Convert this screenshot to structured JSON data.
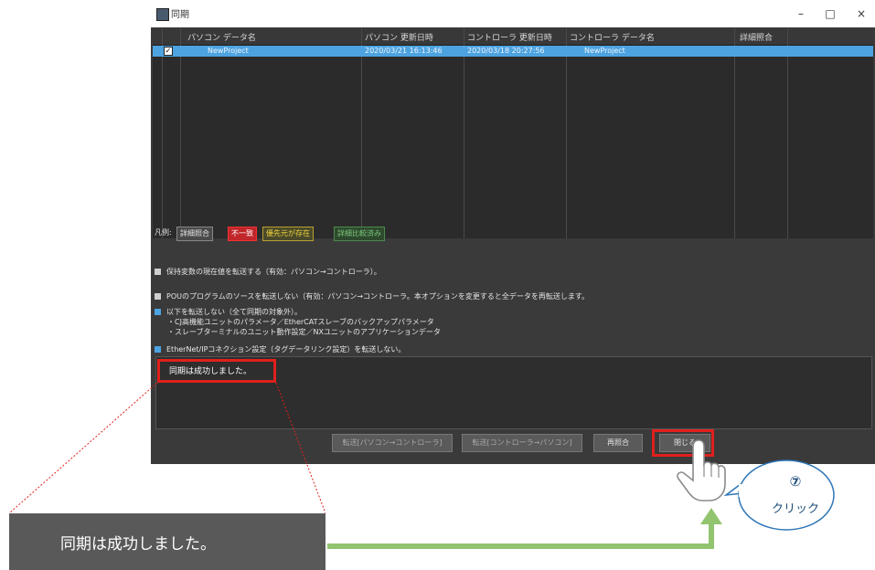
{
  "window": {
    "title": "同期",
    "minimize": "–",
    "maximize": "□",
    "close": "×"
  },
  "grid": {
    "headers": [
      "パソコン データ名",
      "パソコン 更新日時",
      "コントローラ 更新日時",
      "コントローラ データ名",
      "詳細照合"
    ],
    "row": {
      "checked": "✓",
      "pc_name": "NewProject",
      "pc_updated": "2020/03/21 16:13:46",
      "ctrl_updated": "2020/03/18 20:27:56",
      "ctrl_name": "NewProject"
    }
  },
  "legend": {
    "label": "凡例:",
    "items": [
      "詳細照合",
      "不一致",
      "優先元が存在",
      "詳細比較済み"
    ]
  },
  "notes": [
    "保持変数の現在値を転送する（有効：パソコン→コントローラ）。",
    "POUのプログラムのソースを転送しない（有効：パソコン→コントローラ。本オプションを変更すると全データを再転送します。",
    "以下を転送しない（全て同期の対象外）。",
    "・CJ高機能ユニットのパラメータ／EtherCATスレーブのバックアップパラメータ",
    "・スレーブターミナルのユニット動作設定／NXユニットのアプリケーションデータ",
    "EtherNet/IPコネクション設定（タグデータリンク設定）を転送しない。"
  ],
  "log": {
    "message": "同期は成功しました。"
  },
  "buttons": {
    "transfer_to": "転送[パソコン→コントローラ]",
    "transfer_from": "転送[コントローラ→パソコン]",
    "recompare": "再照合",
    "close": "閉じる"
  },
  "zoom": {
    "message": "同期は成功しました。"
  },
  "callout": {
    "number": "⑦",
    "label": "クリック"
  },
  "colors": {
    "highlight": "#e0201c",
    "selection": "#4da3e0",
    "arrow": "#92c46f",
    "callout_border": "#2e75b6"
  }
}
